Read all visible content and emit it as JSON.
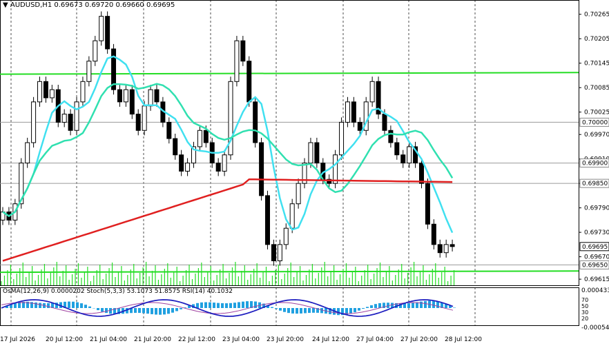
{
  "header": {
    "symbol": "AUDUSD,H1",
    "ohlc": "0.69673 0.69720 0.69660 0.69695"
  },
  "indicator_label": "OsMA(12,26,9) 0.0000202  Stoch(5,3,3) 53.1073 51.8575  RSI(14) 40.1032",
  "colors": {
    "background": "#ffffff",
    "candle": "#000000",
    "ma_fast": "#40e0f0",
    "ma_mid": "#30e0b0",
    "ma_slow": "#e02020",
    "level_line": "#22dd22",
    "volume": "#22dd22",
    "osma": "#20a0e0",
    "stoch_main": "#2020c0",
    "rsi": "#a040a0"
  },
  "chart_data": {
    "type": "candlestick",
    "title": "AUDUSD,H1",
    "y_ticks": [
      "0.70265",
      "0.70205",
      "0.70145",
      "0.70085",
      "0.70025",
      "0.69970",
      "0.69910",
      "0.69850",
      "0.69790",
      "0.69730",
      "0.69670",
      "0.69615"
    ],
    "ylim": [
      0.696,
      0.703
    ],
    "x_ticks": [
      "17 Jul 2026",
      "20 Jul 12:00",
      "21 Jul 04:00",
      "21 Jul 20:00",
      "22 Jul 12:00",
      "23 Jul 04:00",
      "23 Jul 20:00",
      "24 Jul 12:00",
      "27 Jul 04:00",
      "27 Jul 20:00",
      "28 Jul 12:00"
    ],
    "price_labels": [
      {
        "value": 0.7,
        "text": "0.70000",
        "style": "gray"
      },
      {
        "value": 0.699,
        "text": "0.69900",
        "style": "gray"
      },
      {
        "value": 0.6985,
        "text": "0.69850",
        "style": "gray"
      },
      {
        "value": 0.69695,
        "text": "0.69695",
        "style": "black"
      },
      {
        "value": 0.6965,
        "text": "0.69650",
        "style": "gray"
      }
    ],
    "horizontal_levels": [
      0.7,
      0.699,
      0.6985,
      0.6965
    ],
    "green_levels": [
      {
        "from": 0.70118,
        "to": 0.70122
      },
      {
        "from": 0.69632,
        "to": 0.69635
      }
    ],
    "close_path": [
      0.6978,
      0.6976,
      0.698,
      0.699,
      0.6995,
      0.7005,
      0.701,
      0.7006,
      0.7008,
      0.7,
      0.7002,
      0.6998,
      0.7005,
      0.701,
      0.7015,
      0.702,
      0.7026,
      0.7018,
      0.7008,
      0.7005,
      0.7008,
      0.7002,
      0.6998,
      0.7004,
      0.7008,
      0.7005,
      0.7,
      0.6996,
      0.6992,
      0.6988,
      0.699,
      0.6994,
      0.6998,
      0.6995,
      0.699,
      0.6988,
      0.6992,
      0.701,
      0.702,
      0.7015,
      0.7005,
      0.6995,
      0.6982,
      0.697,
      0.6966,
      0.697,
      0.6974,
      0.698,
      0.6985,
      0.699,
      0.6995,
      0.699,
      0.6986,
      0.6985,
      0.6992,
      0.7,
      0.7005,
      0.7,
      0.6998,
      0.7005,
      0.701,
      0.7002,
      0.6998,
      0.6995,
      0.6992,
      0.699,
      0.6994,
      0.699,
      0.6985,
      0.6975,
      0.697,
      0.6968,
      0.697,
      0.69695
    ],
    "osma_range": [
      -0.00054,
      0.00043
    ],
    "osma_ticks": [
      "0.000433",
      "-0.000544"
    ],
    "stoch_ticks": [
      "70",
      "50",
      "30",
      "20"
    ]
  }
}
